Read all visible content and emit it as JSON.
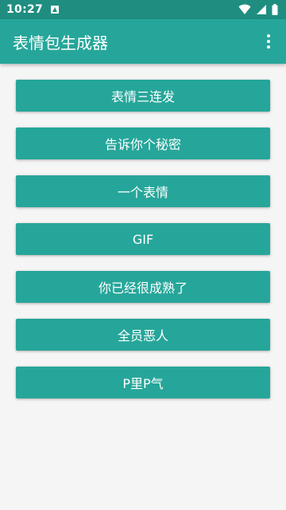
{
  "status_bar": {
    "time": "10:27",
    "background": "#1f8e80"
  },
  "app_bar": {
    "title": "表情包生成器",
    "background": "#26a69a",
    "overflow_icon": "more-vert-icon"
  },
  "buttons": [
    {
      "label": "表情三连发"
    },
    {
      "label": "告诉你个秘密"
    },
    {
      "label": "一个表情"
    },
    {
      "label": "GIF"
    },
    {
      "label": "你已经很成熟了"
    },
    {
      "label": "全员恶人"
    },
    {
      "label": "P里P气"
    }
  ],
  "colors": {
    "accent": "#26a69a",
    "page_background": "#f5f5f5"
  }
}
